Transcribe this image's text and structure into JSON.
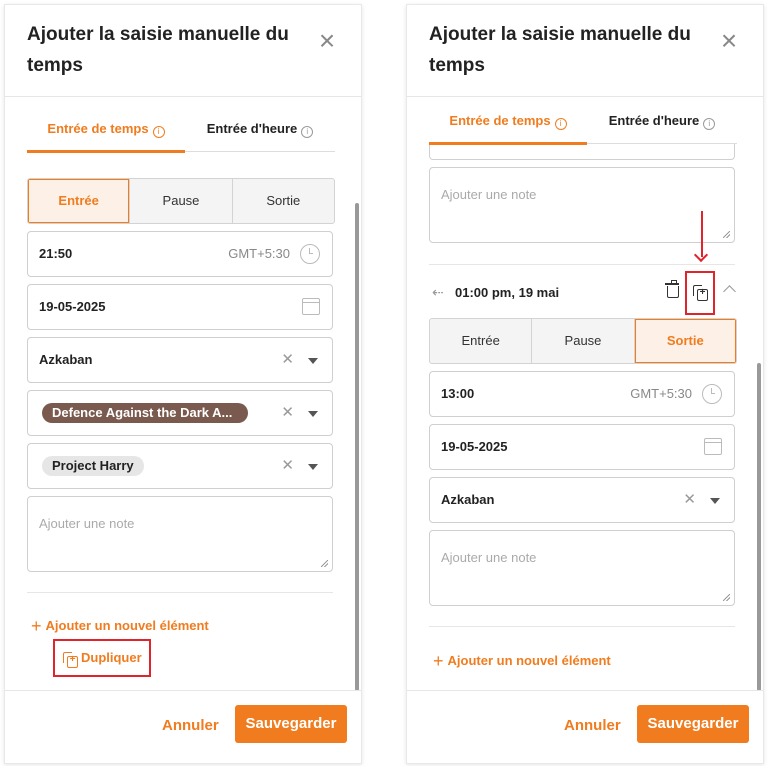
{
  "dialog_title": "Ajouter la saisie manuelle du temps",
  "close_icon": "close-icon",
  "tabs": [
    {
      "label": "Entrée de temps",
      "active": true
    },
    {
      "label": "Entrée d'heure",
      "active": false
    }
  ],
  "segments": [
    "Entrée",
    "Pause",
    "Sortie"
  ],
  "accent_color": "#f07c1f",
  "highlight_color": "#e0242c",
  "left": {
    "active_segment": "Entrée",
    "time": "21:50",
    "timezone": "GMT+5:30",
    "date": "19-05-2025",
    "location": "Azkaban",
    "activity_chip": "Defence Against the Dark A...",
    "project_chip": "Project Harry",
    "note_placeholder": "Ajouter une note",
    "add_item": "Ajouter un nouvel élément",
    "duplicate": "Dupliquer"
  },
  "right": {
    "note_placeholder": "Ajouter une note",
    "entry_title": "01:00 pm, 19 mai",
    "active_segment": "Sortie",
    "time": "13:00",
    "timezone": "GMT+5:30",
    "date": "19-05-2025",
    "location": "Azkaban",
    "note_placeholder_2": "Ajouter une note",
    "add_item": "Ajouter un nouvel élément"
  },
  "footer": {
    "cancel": "Annuler",
    "save": "Sauvegarder"
  }
}
